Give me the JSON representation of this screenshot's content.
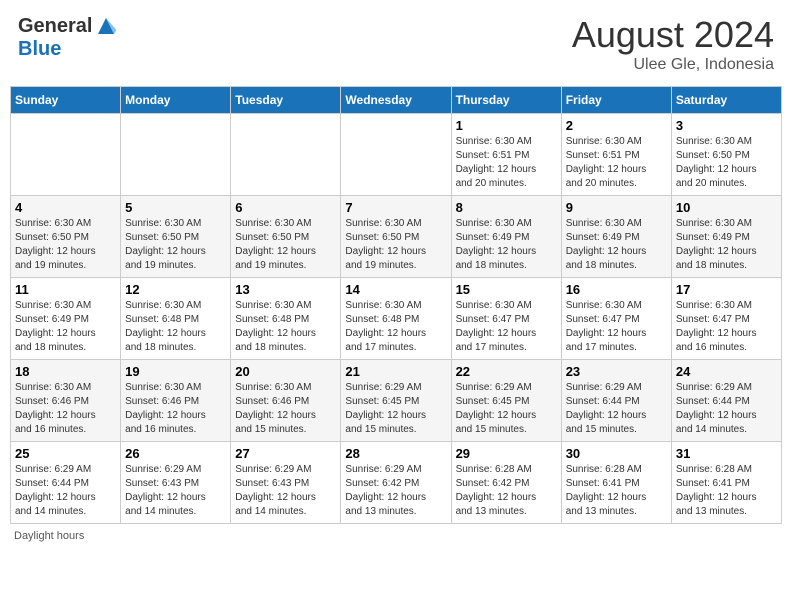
{
  "header": {
    "logo_general": "General",
    "logo_blue": "Blue",
    "month_year": "August 2024",
    "location": "Ulee Gle, Indonesia"
  },
  "days_of_week": [
    "Sunday",
    "Monday",
    "Tuesday",
    "Wednesday",
    "Thursday",
    "Friday",
    "Saturday"
  ],
  "weeks": [
    {
      "days": [
        {
          "num": "",
          "info": ""
        },
        {
          "num": "",
          "info": ""
        },
        {
          "num": "",
          "info": ""
        },
        {
          "num": "",
          "info": ""
        },
        {
          "num": "1",
          "info": "Sunrise: 6:30 AM\nSunset: 6:51 PM\nDaylight: 12 hours\nand 20 minutes."
        },
        {
          "num": "2",
          "info": "Sunrise: 6:30 AM\nSunset: 6:51 PM\nDaylight: 12 hours\nand 20 minutes."
        },
        {
          "num": "3",
          "info": "Sunrise: 6:30 AM\nSunset: 6:50 PM\nDaylight: 12 hours\nand 20 minutes."
        }
      ]
    },
    {
      "days": [
        {
          "num": "4",
          "info": "Sunrise: 6:30 AM\nSunset: 6:50 PM\nDaylight: 12 hours\nand 19 minutes."
        },
        {
          "num": "5",
          "info": "Sunrise: 6:30 AM\nSunset: 6:50 PM\nDaylight: 12 hours\nand 19 minutes."
        },
        {
          "num": "6",
          "info": "Sunrise: 6:30 AM\nSunset: 6:50 PM\nDaylight: 12 hours\nand 19 minutes."
        },
        {
          "num": "7",
          "info": "Sunrise: 6:30 AM\nSunset: 6:50 PM\nDaylight: 12 hours\nand 19 minutes."
        },
        {
          "num": "8",
          "info": "Sunrise: 6:30 AM\nSunset: 6:49 PM\nDaylight: 12 hours\nand 18 minutes."
        },
        {
          "num": "9",
          "info": "Sunrise: 6:30 AM\nSunset: 6:49 PM\nDaylight: 12 hours\nand 18 minutes."
        },
        {
          "num": "10",
          "info": "Sunrise: 6:30 AM\nSunset: 6:49 PM\nDaylight: 12 hours\nand 18 minutes."
        }
      ]
    },
    {
      "days": [
        {
          "num": "11",
          "info": "Sunrise: 6:30 AM\nSunset: 6:49 PM\nDaylight: 12 hours\nand 18 minutes."
        },
        {
          "num": "12",
          "info": "Sunrise: 6:30 AM\nSunset: 6:48 PM\nDaylight: 12 hours\nand 18 minutes."
        },
        {
          "num": "13",
          "info": "Sunrise: 6:30 AM\nSunset: 6:48 PM\nDaylight: 12 hours\nand 18 minutes."
        },
        {
          "num": "14",
          "info": "Sunrise: 6:30 AM\nSunset: 6:48 PM\nDaylight: 12 hours\nand 17 minutes."
        },
        {
          "num": "15",
          "info": "Sunrise: 6:30 AM\nSunset: 6:47 PM\nDaylight: 12 hours\nand 17 minutes."
        },
        {
          "num": "16",
          "info": "Sunrise: 6:30 AM\nSunset: 6:47 PM\nDaylight: 12 hours\nand 17 minutes."
        },
        {
          "num": "17",
          "info": "Sunrise: 6:30 AM\nSunset: 6:47 PM\nDaylight: 12 hours\nand 16 minutes."
        }
      ]
    },
    {
      "days": [
        {
          "num": "18",
          "info": "Sunrise: 6:30 AM\nSunset: 6:46 PM\nDaylight: 12 hours\nand 16 minutes."
        },
        {
          "num": "19",
          "info": "Sunrise: 6:30 AM\nSunset: 6:46 PM\nDaylight: 12 hours\nand 16 minutes."
        },
        {
          "num": "20",
          "info": "Sunrise: 6:30 AM\nSunset: 6:46 PM\nDaylight: 12 hours\nand 15 minutes."
        },
        {
          "num": "21",
          "info": "Sunrise: 6:29 AM\nSunset: 6:45 PM\nDaylight: 12 hours\nand 15 minutes."
        },
        {
          "num": "22",
          "info": "Sunrise: 6:29 AM\nSunset: 6:45 PM\nDaylight: 12 hours\nand 15 minutes."
        },
        {
          "num": "23",
          "info": "Sunrise: 6:29 AM\nSunset: 6:44 PM\nDaylight: 12 hours\nand 15 minutes."
        },
        {
          "num": "24",
          "info": "Sunrise: 6:29 AM\nSunset: 6:44 PM\nDaylight: 12 hours\nand 14 minutes."
        }
      ]
    },
    {
      "days": [
        {
          "num": "25",
          "info": "Sunrise: 6:29 AM\nSunset: 6:44 PM\nDaylight: 12 hours\nand 14 minutes."
        },
        {
          "num": "26",
          "info": "Sunrise: 6:29 AM\nSunset: 6:43 PM\nDaylight: 12 hours\nand 14 minutes."
        },
        {
          "num": "27",
          "info": "Sunrise: 6:29 AM\nSunset: 6:43 PM\nDaylight: 12 hours\nand 14 minutes."
        },
        {
          "num": "28",
          "info": "Sunrise: 6:29 AM\nSunset: 6:42 PM\nDaylight: 12 hours\nand 13 minutes."
        },
        {
          "num": "29",
          "info": "Sunrise: 6:28 AM\nSunset: 6:42 PM\nDaylight: 12 hours\nand 13 minutes."
        },
        {
          "num": "30",
          "info": "Sunrise: 6:28 AM\nSunset: 6:41 PM\nDaylight: 12 hours\nand 13 minutes."
        },
        {
          "num": "31",
          "info": "Sunrise: 6:28 AM\nSunset: 6:41 PM\nDaylight: 12 hours\nand 13 minutes."
        }
      ]
    }
  ],
  "footer": {
    "note": "Daylight hours"
  }
}
